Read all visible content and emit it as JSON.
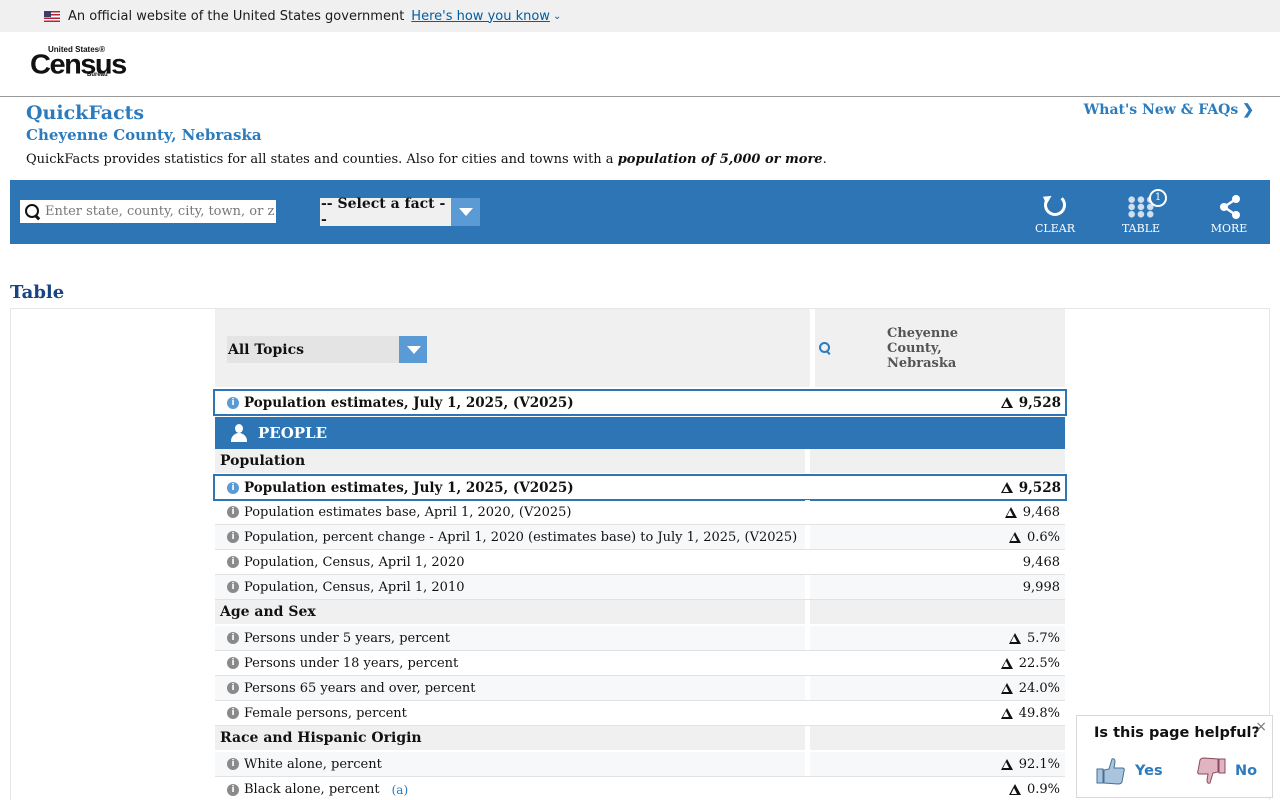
{
  "gov_banner": {
    "text": "An official website of the United States government",
    "link": "Here's how you know"
  },
  "logo": {
    "line1": "United States®",
    "line2": "Census",
    "line3": "Bureau"
  },
  "page": {
    "title": "QuickFacts",
    "subtitle": "Cheyenne County, Nebraska",
    "whats_new": "What's New & FAQs",
    "description_prefix": "QuickFacts provides statistics for all states and counties. Also for cities and towns with a ",
    "description_emphasis": "population of 5,000 or more",
    "description_suffix": "."
  },
  "toolbar": {
    "search_placeholder": "Enter state, county, city, town, or zip code",
    "fact_select": "-- Select a fact --",
    "clear": "CLEAR",
    "table": "TABLE",
    "table_badge": "1",
    "more": "MORE"
  },
  "table": {
    "heading": "Table",
    "topics_select": "All Topics",
    "column_name": "Cheyenne County, Nebraska",
    "top_row": {
      "label": "Population estimates, July 1, 2025, (V2025)",
      "value": "9,528"
    },
    "section": "PEOPLE",
    "groups": {
      "population": "Population",
      "age_sex": "Age and Sex",
      "race": "Race and Hispanic Origin"
    },
    "rows": [
      {
        "label": "Population estimates, July 1, 2025, (V2025)",
        "value": "9,528"
      },
      {
        "label": "Population estimates base, April 1, 2020, (V2025)",
        "value": "9,468"
      },
      {
        "label": "Population, percent change - April 1, 2020 (estimates base) to July 1, 2025, (V2025)",
        "value": "0.6%"
      },
      {
        "label": "Population, Census, April 1, 2020",
        "value": "9,468"
      },
      {
        "label": "Population, Census, April 1, 2010",
        "value": "9,998"
      },
      {
        "label": "Persons under 5 years, percent",
        "value": "5.7%"
      },
      {
        "label": "Persons under 18 years, percent",
        "value": "22.5%"
      },
      {
        "label": "Persons 65 years and over, percent",
        "value": "24.0%"
      },
      {
        "label": "Female persons, percent",
        "value": "49.8%"
      },
      {
        "label": "White alone, percent",
        "value": "92.1%"
      },
      {
        "label": "Black alone, percent",
        "value": "0.9%",
        "footnote": "(a)"
      }
    ]
  },
  "feedback": {
    "question": "Is this page helpful?",
    "yes": "Yes",
    "no": "No",
    "close": "×"
  },
  "colors": {
    "brand_blue": "#2e75b6",
    "link_blue": "#2b7bbd",
    "gov_link": "#005ea2"
  }
}
